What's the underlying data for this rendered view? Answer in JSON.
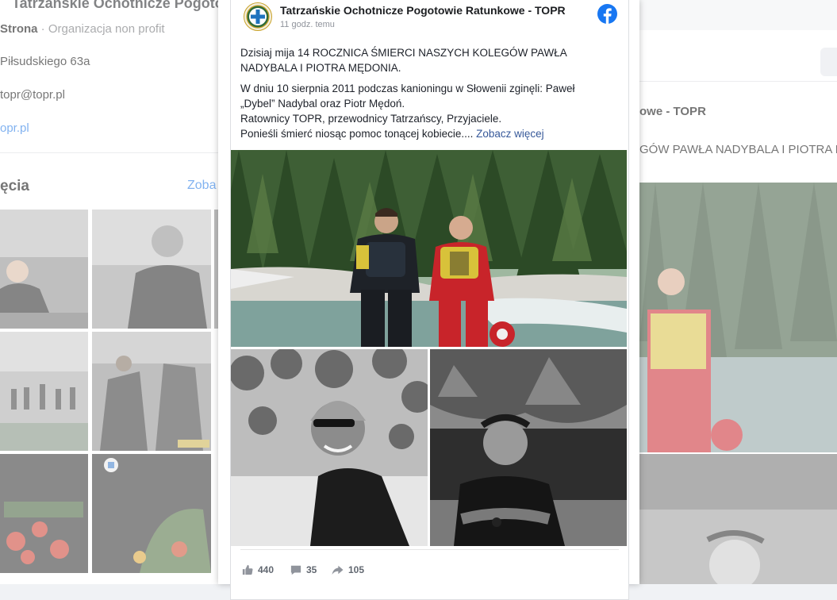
{
  "background": {
    "page_title": "Tatrzańskie Ochotnicze Pogotowie",
    "category_bold": "Strona",
    "category_text": " · Organizacja non profit",
    "address": "Piłsudskiego 63a",
    "email": "topr@topr.pl",
    "website": "opr.pl",
    "photos_heading": "ęcia",
    "photos_see_all": "Zoba",
    "right_author": "owe - TOPR",
    "right_text": "GÓW PAWŁA NADYBALA I PIOTRA MĘ"
  },
  "post": {
    "author": "Tatrzańskie Ochotnicze Pogotowie Ratunkowe - TOPR",
    "timestamp": "11 godz. temu",
    "headline": "Dzisiaj mija 14 ROCZNICA ŚMIERCI NASZYCH KOLEGÓW PAWŁA NADYBALA I PIOTRA MĘDONIA.",
    "body_lines": [
      "W dniu 10 sierpnia 2011 podczas kanioningu w Słowenii zginęli: Paweł",
      "„Dybel” Nadybal oraz Piotr Mędoń.",
      "Ratownicy TOPR, przewodnicy Tatrzańscy, Przyjaciele.",
      "Ponieśli śmierć niosąc pomoc tonącej kobiecie.... "
    ],
    "see_more": "Zobacz więcej",
    "stats": {
      "likes": "440",
      "comments": "35",
      "shares": "105"
    }
  },
  "colors": {
    "facebook_blue": "#1877f2",
    "link": "#365899",
    "avatar_green": "#2f6b3a",
    "avatar_gold": "#c9a227"
  },
  "icons": {
    "facebook": "facebook-logo-icon",
    "like": "thumbs-up-icon",
    "comment": "comment-bubble-icon",
    "share": "share-arrow-icon"
  }
}
